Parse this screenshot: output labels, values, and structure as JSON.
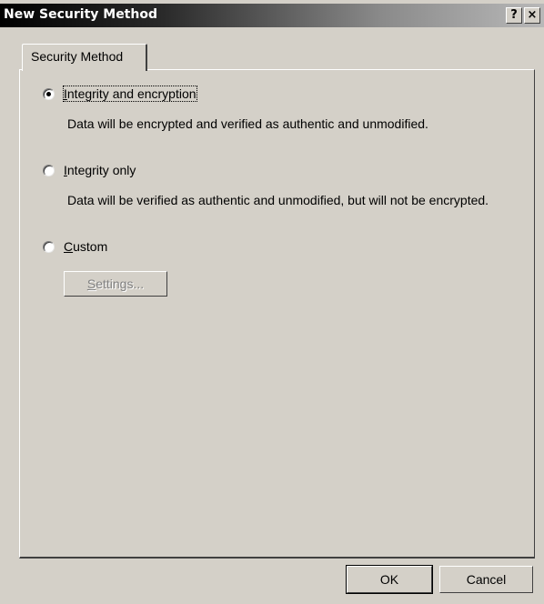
{
  "window": {
    "title": "New Security Method",
    "help_label": "?",
    "close_label": "×"
  },
  "tabs": [
    {
      "label": "Security Method",
      "selected": true
    }
  ],
  "options": [
    {
      "label_first": "I",
      "label_rest": "ntegrity and encryption",
      "description": "Data will be encrypted and verified as authentic and unmodified.",
      "selected": true
    },
    {
      "label_first": "I",
      "label_rest": "ntegrity only",
      "description": "Data will be verified as authentic and unmodified, but will not be encrypted.",
      "selected": false
    },
    {
      "label_first": "C",
      "label_rest": "ustom",
      "selected": false
    }
  ],
  "settings_button": {
    "label_first": "S",
    "label_rest": "ettings...",
    "enabled": false
  },
  "buttons": {
    "ok": "OK",
    "cancel": "Cancel"
  }
}
